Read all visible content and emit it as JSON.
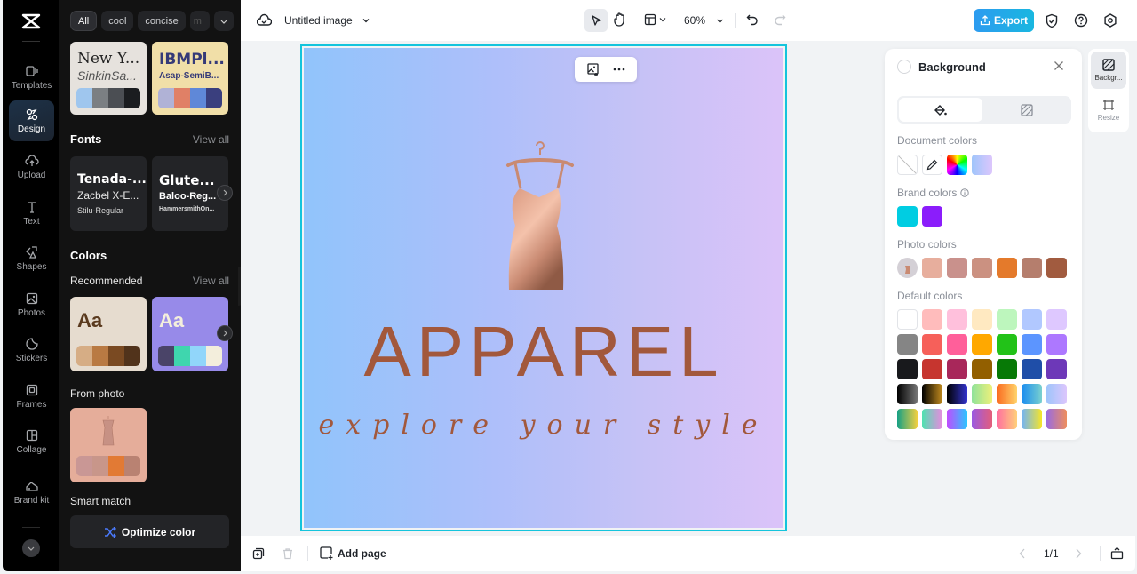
{
  "app": {
    "title": "Untitled image",
    "zoom": "60%",
    "export_label": "Export"
  },
  "rail": {
    "items": [
      {
        "label": "Templates",
        "icon": "templates-icon"
      },
      {
        "label": "Design",
        "icon": "design-icon",
        "active": true
      },
      {
        "label": "Upload",
        "icon": "upload-icon"
      },
      {
        "label": "Text",
        "icon": "text-icon"
      },
      {
        "label": "Shapes",
        "icon": "shapes-icon"
      },
      {
        "label": "Photos",
        "icon": "photos-icon"
      },
      {
        "label": "Stickers",
        "icon": "stickers-icon"
      },
      {
        "label": "Frames",
        "icon": "frames-icon"
      },
      {
        "label": "Collage",
        "icon": "collage-icon"
      },
      {
        "label": "Brand kit",
        "icon": "brand-kit-icon"
      }
    ]
  },
  "panel": {
    "chips": [
      "All",
      "cool",
      "concise",
      "m"
    ],
    "style_cards": [
      {
        "line1": "New Y...",
        "line2": "SinkinSa...",
        "bg": "#e6e2dd",
        "colors": [
          "#9fc6ee",
          "#7b7f83",
          "#4b4e53",
          "#1b1d20"
        ]
      },
      {
        "line1": "IBMPl...",
        "line2": "Asap-SemiB...",
        "bg": "#f1dfa8",
        "colors": [
          "#b0b2d6",
          "#e08066",
          "#5f88d8",
          "#3a3f7e"
        ]
      }
    ],
    "fonts": {
      "title": "Fonts",
      "view_all": "View all",
      "cards": [
        {
          "line1": "Tenada-...",
          "line2": "Zacbel X-E...",
          "line3": "Stilu-Regular"
        },
        {
          "line1": "Glute...",
          "line2": "Baloo-Reg...",
          "line3": "HammersmithOn..."
        }
      ]
    },
    "colors": {
      "title": "Colors",
      "recommended_label": "Recommended",
      "view_all": "View all",
      "cards": [
        {
          "label": "Aa",
          "bg": "#e6dccf",
          "text_color": "#5a3a1e",
          "colors": [
            "#d6ad85",
            "#b97a43",
            "#7a4a22",
            "#51331b"
          ]
        },
        {
          "label": "Aa",
          "bg": "#978ae9",
          "text_color": "#f4efdc",
          "colors": [
            "#4a4468",
            "#3fd6ae",
            "#91d6fa",
            "#f3eedc"
          ]
        }
      ],
      "from_photo_label": "From photo",
      "from_photo": {
        "bg": "#e5ad9a",
        "colors": [
          "#c99795",
          "#c8968a",
          "#e27a34",
          "#b98272"
        ]
      },
      "smart_match_label": "Smart match",
      "optimize_label": "Optimize color"
    }
  },
  "canvas": {
    "headline": "APPAREL",
    "tagline": "explore your style",
    "text_color": "#a2583c"
  },
  "background_panel": {
    "title": "Background",
    "document_colors_label": "Document colors",
    "brand_colors_label": "Brand colors",
    "brand_colors": [
      "#00cde2",
      "#8b1dfb"
    ],
    "photo_colors_label": "Photo colors",
    "photo_colors": [
      "#e7ae9d",
      "#c9918c",
      "#cb9181",
      "#e47a2b",
      "#b57e6d",
      "#a15b3f"
    ],
    "default_colors_label": "Default colors",
    "default_colors": [
      [
        "#ffffff",
        "#ffbcbc",
        "#ffc0dc",
        "#ffe9c1",
        "#bdf6bd",
        "#b1c8ff",
        "#dec8ff"
      ],
      [
        "#858585",
        "#f6605a",
        "#ff5f9a",
        "#ffa800",
        "#22c218",
        "#5c95ff",
        "#ad78ff"
      ],
      [
        "#18191c",
        "#c6352f",
        "#a8275a",
        "#925f00",
        "#077906",
        "#1f4ea8",
        "#6d38b8"
      ],
      [
        "linear-gradient(90deg,#000,#777)",
        "linear-gradient(90deg,#000,#c28b1e)",
        "linear-gradient(90deg,#000,#3434d0)",
        "linear-gradient(90deg,#8fe29a,#eef07a)",
        "linear-gradient(90deg,#fa6b20,#ffd36b)",
        "linear-gradient(90deg,#1a8cf0,#7ad1cf)",
        "linear-gradient(90deg,#9fc5fb,#dcc6fc)"
      ],
      [
        "linear-gradient(90deg,#16a085,#f4d03f)",
        "linear-gradient(90deg,#4ee2b0,#e98ae0)",
        "linear-gradient(90deg,#c14bff,#29c7ff)",
        "linear-gradient(90deg,#9a5ae2,#e45e7a)",
        "linear-gradient(90deg,#ff6fa0,#ffd07a)",
        "linear-gradient(90deg,#6fb3f7,#f6e52a)",
        "linear-gradient(90deg,#9a6be0,#ee8e5e)"
      ]
    ]
  },
  "side_tabs": [
    {
      "label": "Backgr...",
      "active": true
    },
    {
      "label": "Resize"
    }
  ],
  "bottom": {
    "add_page_label": "Add page",
    "page_indicator": "1/1"
  }
}
